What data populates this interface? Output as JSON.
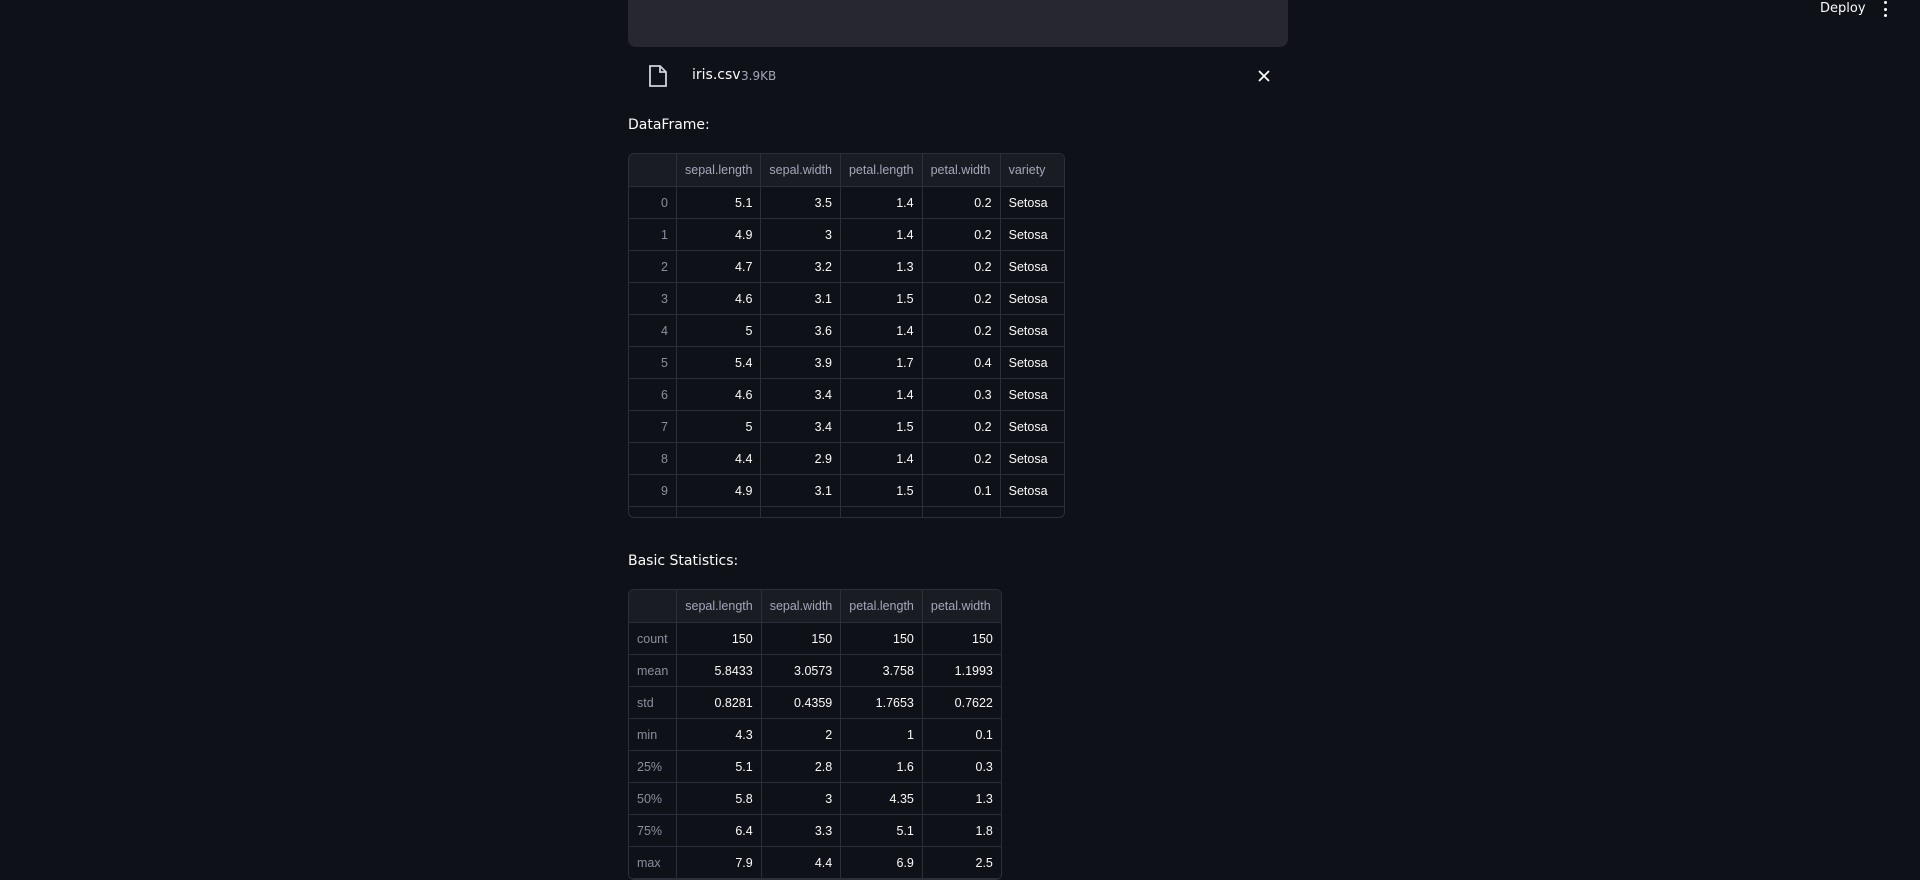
{
  "header": {
    "deploy_label": "Deploy",
    "menu_icon": "kebab-menu-icon"
  },
  "file": {
    "name": "iris.csv",
    "size": "3.9KB",
    "icon": "file-icon",
    "close_icon": "close-icon"
  },
  "dataframe": {
    "heading": "DataFrame:",
    "columns": [
      "",
      "sepal.length",
      "sepal.width",
      "petal.length",
      "petal.width",
      "variety"
    ],
    "rows": [
      [
        "0",
        "5.1",
        "3.5",
        "1.4",
        "0.2",
        "Setosa"
      ],
      [
        "1",
        "4.9",
        "3",
        "1.4",
        "0.2",
        "Setosa"
      ],
      [
        "2",
        "4.7",
        "3.2",
        "1.3",
        "0.2",
        "Setosa"
      ],
      [
        "3",
        "4.6",
        "3.1",
        "1.5",
        "0.2",
        "Setosa"
      ],
      [
        "4",
        "5",
        "3.6",
        "1.4",
        "0.2",
        "Setosa"
      ],
      [
        "5",
        "5.4",
        "3.9",
        "1.7",
        "0.4",
        "Setosa"
      ],
      [
        "6",
        "4.6",
        "3.4",
        "1.4",
        "0.3",
        "Setosa"
      ],
      [
        "7",
        "5",
        "3.4",
        "1.5",
        "0.2",
        "Setosa"
      ],
      [
        "8",
        "4.4",
        "2.9",
        "1.4",
        "0.2",
        "Setosa"
      ],
      [
        "9",
        "4.9",
        "3.1",
        "1.5",
        "0.1",
        "Setosa"
      ]
    ]
  },
  "statistics": {
    "heading": "Basic Statistics:",
    "columns": [
      "",
      "sepal.length",
      "sepal.width",
      "petal.length",
      "petal.width"
    ],
    "rows": [
      [
        "count",
        "150",
        "150",
        "150",
        "150"
      ],
      [
        "mean",
        "5.8433",
        "3.0573",
        "3.758",
        "1.1993"
      ],
      [
        "std",
        "0.8281",
        "0.4359",
        "1.7653",
        "0.7622"
      ],
      [
        "min",
        "4.3",
        "2",
        "1",
        "0.1"
      ],
      [
        "25%",
        "5.1",
        "2.8",
        "1.6",
        "0.3"
      ],
      [
        "50%",
        "5.8",
        "3",
        "4.35",
        "1.3"
      ],
      [
        "75%",
        "6.4",
        "3.3",
        "5.1",
        "1.8"
      ],
      [
        "max",
        "7.9",
        "4.4",
        "6.9",
        "2.5"
      ]
    ]
  },
  "colors": {
    "background": "#0e1117",
    "panel": "#262730",
    "grid": "#2c2f38",
    "muted_text": "#a3a8b8"
  }
}
